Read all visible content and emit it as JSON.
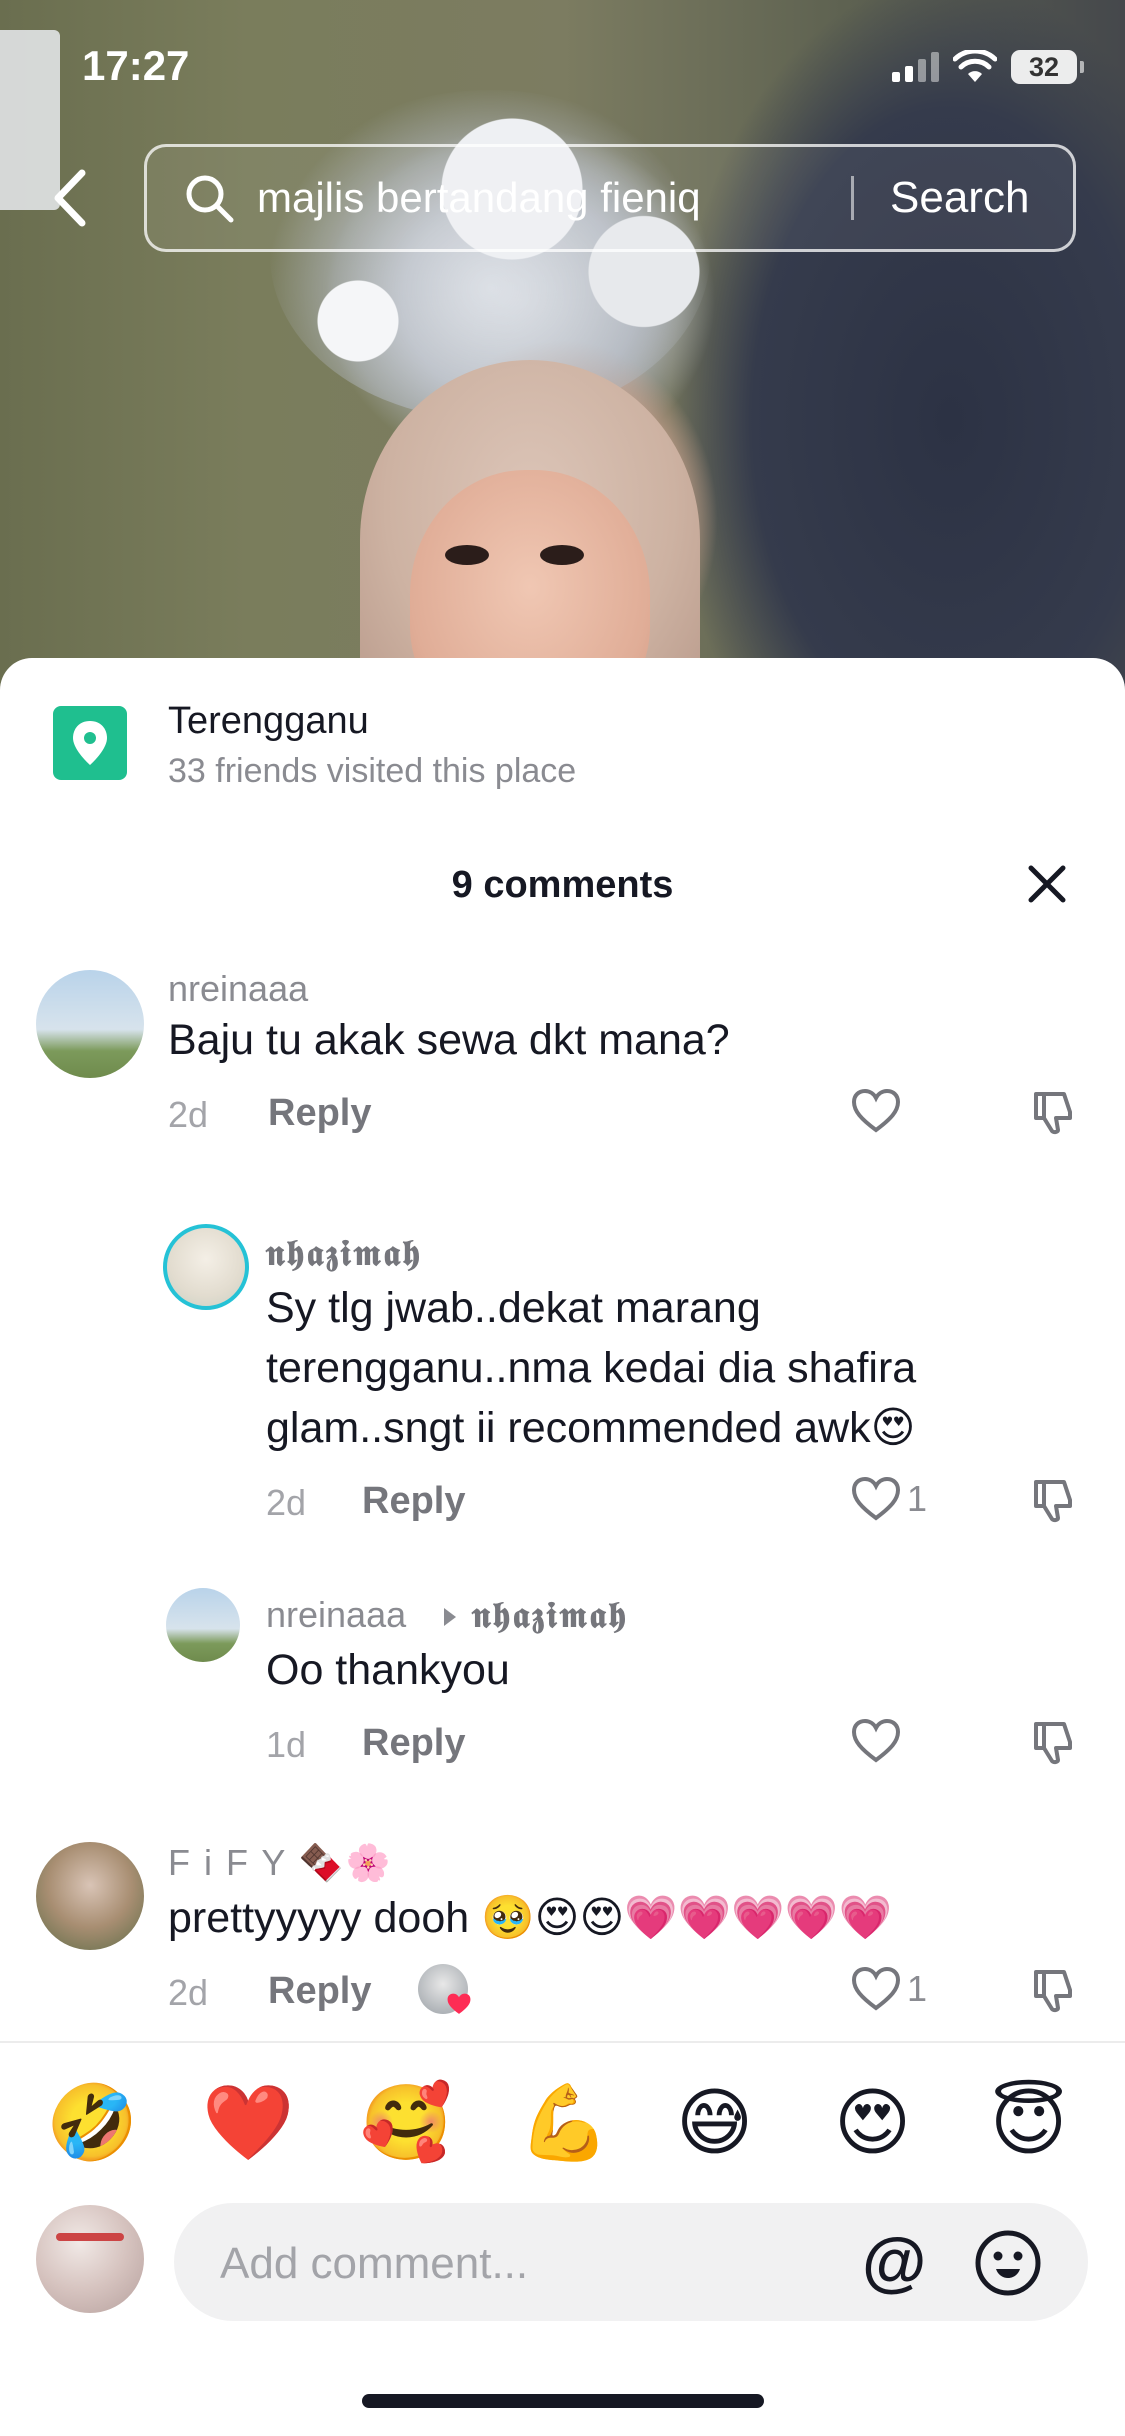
{
  "status_bar": {
    "time": "17:27",
    "battery": "32"
  },
  "search": {
    "query": "majlis bertandang fieniq",
    "button_label": "Search"
  },
  "location": {
    "name": "Terengganu",
    "subtitle": "33 friends visited this place"
  },
  "comments_header": {
    "title": "9 comments"
  },
  "comments": [
    {
      "username": "nreinaaa",
      "text": "Baju tu akak sewa dkt mana?",
      "time": "2d",
      "reply_label": "Reply",
      "likes": ""
    },
    {
      "username": "𝖓𝖍𝖆𝖟𝖎𝖒𝖆𝖍",
      "text_line1": "Sy tlg jwab..dekat marang",
      "text_line2": "terengganu..nma kedai dia shafira",
      "text_line3": "glam..sngt ii recommended awk😍",
      "time": "2d",
      "reply_label": "Reply",
      "likes": "1"
    },
    {
      "username": "nreinaaa",
      "reply_to": "𝖓𝖍𝖆𝖟𝖎𝖒𝖆𝖍",
      "text": "Oo thankyou",
      "time": "1d",
      "reply_label": "Reply",
      "likes": ""
    },
    {
      "username": "F i F Y 🍫🌸",
      "text": "prettyyyyy dooh 🥹😍😍💗💗💗💗💗",
      "time": "2d",
      "reply_label": "Reply",
      "likes": "1"
    }
  ],
  "emoji_bar": [
    "🤣",
    "❤️",
    "🥰",
    "💪",
    "😅",
    "😍",
    "😇"
  ],
  "input": {
    "placeholder": "Add comment...",
    "mention_symbol": "@"
  },
  "colors": {
    "location_green": "#1fbf8f",
    "text_primary": "#161823",
    "text_secondary": "#8a8b91"
  }
}
